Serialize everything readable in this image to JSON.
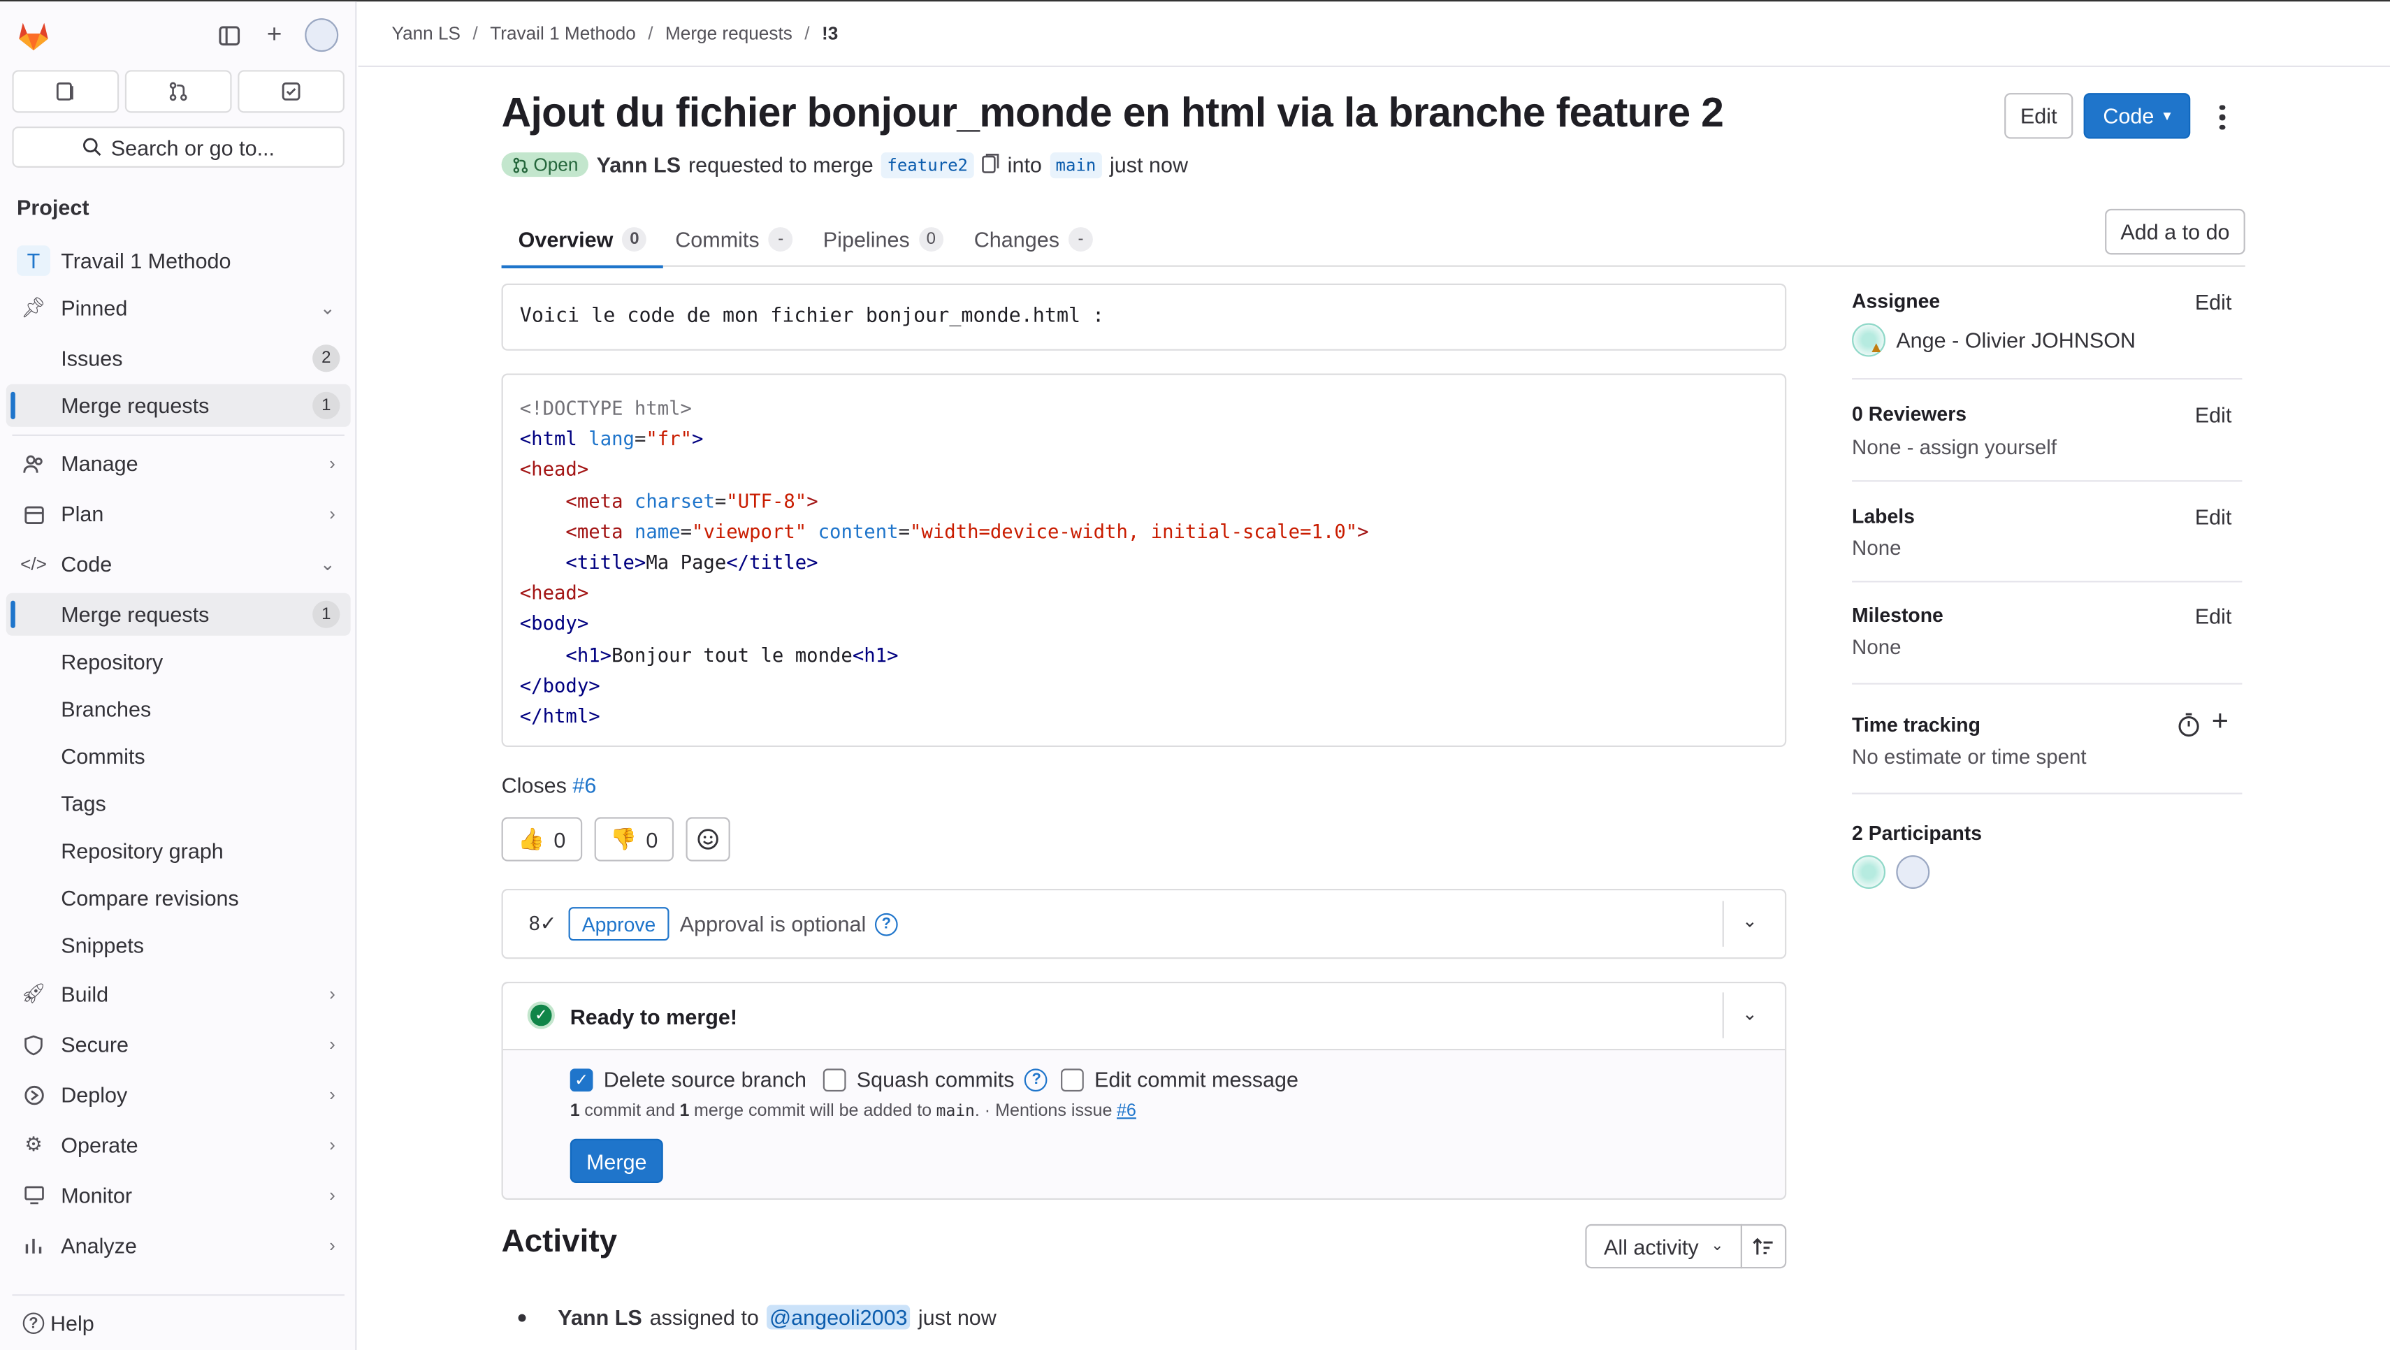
{
  "breadcrumb": [
    "Yann LS",
    "Travail 1 Methodo",
    "Merge requests",
    "!3"
  ],
  "sidebar": {
    "search_label": "Search or go to...",
    "section": "Project",
    "project_initial": "T",
    "project_name": "Travail 1 Methodo",
    "pinned": "Pinned",
    "pinned_items": [
      {
        "label": "Issues",
        "count": "2"
      },
      {
        "label": "Merge requests",
        "count": "1"
      }
    ],
    "manage": "Manage",
    "plan": "Plan",
    "code": "Code",
    "code_items": [
      {
        "label": "Merge requests",
        "count": "1"
      },
      {
        "label": "Repository"
      },
      {
        "label": "Branches"
      },
      {
        "label": "Commits"
      },
      {
        "label": "Tags"
      },
      {
        "label": "Repository graph"
      },
      {
        "label": "Compare revisions"
      },
      {
        "label": "Snippets"
      }
    ],
    "build": "Build",
    "secure": "Secure",
    "deploy": "Deploy",
    "operate": "Operate",
    "monitor": "Monitor",
    "analyze": "Analyze",
    "help": "Help"
  },
  "mr": {
    "title": "Ajout du fichier bonjour_monde en html via la branche feature 2",
    "edit_label": "Edit",
    "code_label": "Code",
    "status": "Open",
    "author": "Yann LS",
    "requested_text": "requested to merge",
    "source_branch": "feature2",
    "into_text": "into",
    "target_branch": "main",
    "time": "just now",
    "add_todo": "Add a to do"
  },
  "tabs": [
    {
      "label": "Overview",
      "count": "0"
    },
    {
      "label": "Commits",
      "count": "-"
    },
    {
      "label": "Pipelines",
      "count": "0"
    },
    {
      "label": "Changes",
      "count": "-"
    }
  ],
  "description": {
    "intro": "Voici le code de mon fichier bonjour_monde.html :",
    "code_lines": [
      "<!DOCTYPE html>",
      "<html lang=\"fr\">",
      "<head>",
      "    <meta charset=\"UTF-8\">",
      "    <meta name=\"viewport\" content=\"width=device-width, initial-scale=1.0\">",
      "    <title>Ma Page</title>",
      "<head>",
      "<body>",
      "    <h1>Bonjour tout le monde<h1>",
      "</body>",
      "</html>"
    ],
    "closes_label": "Closes",
    "closes_issue": "#6"
  },
  "reactions": {
    "thumbs_up": "0",
    "thumbs_down": "0"
  },
  "approval": {
    "approve_label": "Approve",
    "optional_text": "Approval is optional"
  },
  "merge": {
    "ready_text": "Ready to merge!",
    "delete_source": "Delete source branch",
    "delete_source_checked": true,
    "squash": "Squash commits",
    "edit_message": "Edit commit message",
    "commit_count": "1",
    "commit_text": "commit and",
    "merge_count": "1",
    "merge_text": "merge commit will be added to",
    "branch": "main",
    "mentions": ". · Mentions issue",
    "issue": "#6",
    "merge_button": "Merge"
  },
  "activity": {
    "title": "Activity",
    "filter": "All activity",
    "entry_author": "Yann LS",
    "entry_action": "assigned to",
    "entry_user": "@angeoli2003",
    "entry_time": "just now"
  },
  "right_sidebar": {
    "assignee_label": "Assignee",
    "assignee_name": "Ange - Olivier JOHNSON",
    "reviewers_label": "0 Reviewers",
    "reviewers_value": "None - assign yourself",
    "labels_label": "Labels",
    "labels_value": "None",
    "milestone_label": "Milestone",
    "milestone_value": "None",
    "time_label": "Time tracking",
    "time_value": "No estimate or time spent",
    "participants_label": "2 Participants",
    "edit": "Edit"
  },
  "colors": {
    "accent": "#1f75cb",
    "open_bg": "#c3e6cd",
    "success": "#108548"
  }
}
